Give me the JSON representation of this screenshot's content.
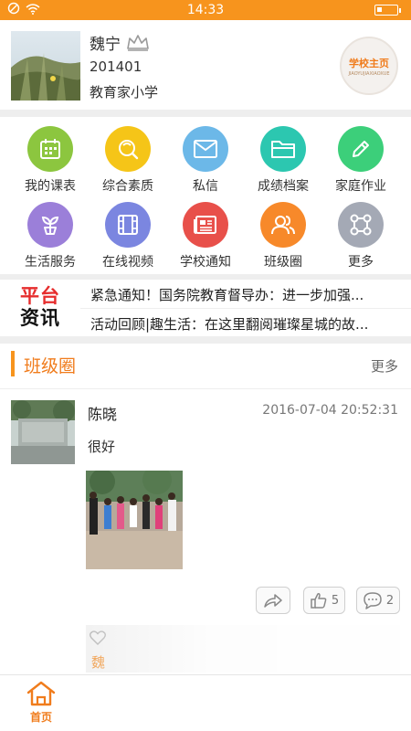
{
  "status_bar": {
    "time": "14:33"
  },
  "profile": {
    "name": "魏宁",
    "id": "201401",
    "school": "教育家小学",
    "school_btn_title": "学校主页",
    "school_btn_sub": "JIAOYUJIAXIAOXUE"
  },
  "grid": {
    "items": [
      {
        "label": "我的课表",
        "color": "#8cc63f",
        "icon": "calendar-icon"
      },
      {
        "label": "综合素质",
        "color": "#f5c518",
        "icon": "quality-icon"
      },
      {
        "label": "私信",
        "color": "#6cb8e8",
        "icon": "mail-icon"
      },
      {
        "label": "成绩档案",
        "color": "#2cc7b0",
        "icon": "folder-icon"
      },
      {
        "label": "家庭作业",
        "color": "#3ccf7a",
        "icon": "pencil-icon"
      },
      {
        "label": "生活服务",
        "color": "#9b7fd9",
        "icon": "plant-icon"
      },
      {
        "label": "在线视频",
        "color": "#7b86e0",
        "icon": "film-icon"
      },
      {
        "label": "学校通知",
        "color": "#e8504a",
        "icon": "notice-icon"
      },
      {
        "label": "班级圈",
        "color": "#f7892a",
        "icon": "users-icon"
      },
      {
        "label": "更多",
        "color": "#a4a9b5",
        "icon": "more-icon"
      }
    ]
  },
  "news": {
    "logo_line1": "平台",
    "logo_line2": "资讯",
    "items": [
      "紧急通知！国务院教育督导办：进一步加强...",
      "活动回顾|趣生活：在这里翻阅璀璨星城的故..."
    ]
  },
  "class_circle": {
    "title": "班级圈",
    "more": "更多",
    "post": {
      "author": "陈晓",
      "time": "2016-07-04 20:52:31",
      "text": "很好",
      "likes": "5",
      "comments": "2",
      "liker_initial": "魏"
    }
  },
  "bottom_nav": {
    "home_label": "首页"
  }
}
